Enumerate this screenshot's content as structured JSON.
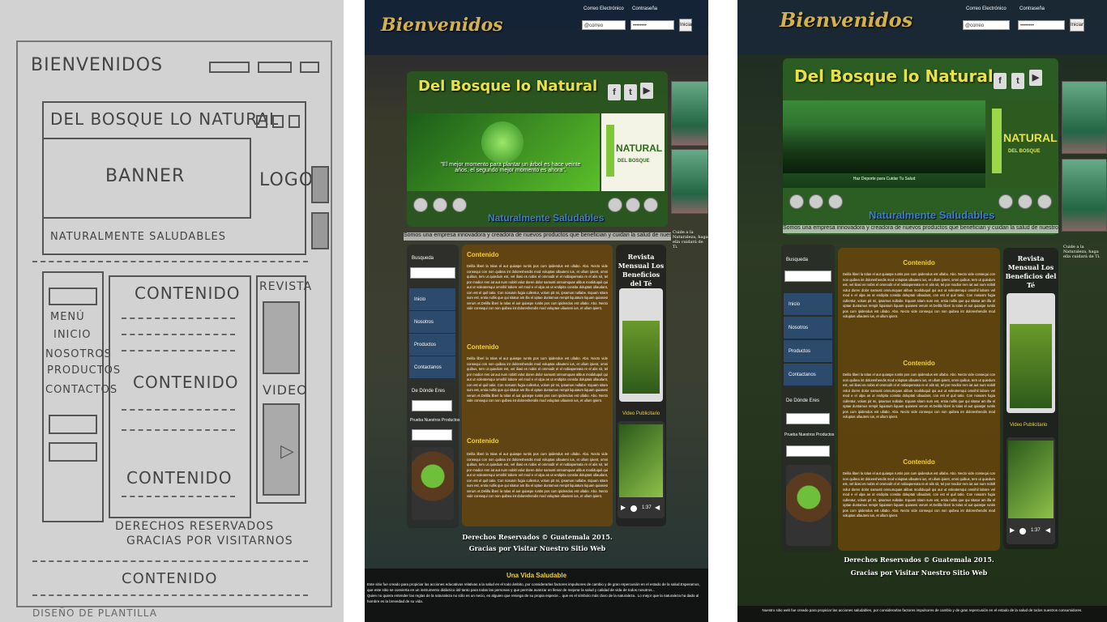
{
  "sketch": {
    "title": "BIENVENIDOS",
    "header_title": "DEL BOSQUE LO NATURAL",
    "banner": "BANNER",
    "logo": "LOGO",
    "tagline": "NATURALMENTE SALUDABLES",
    "menu": [
      "MENÚ",
      "INICIO",
      "NOSOTROS",
      "PRODUCTOS",
      "CONTACTOS"
    ],
    "contenido": [
      "CONTENIDO",
      "CONTENIDO",
      "CONTENIDO"
    ],
    "revista": "REVISTA",
    "video": "VIDEO",
    "footer1": "DERECHOS RESERVADOS",
    "footer2": "GRACIAS POR VISITARNOS",
    "bottom": "CONTENIDO",
    "corner": "DISEÑO DE PLANTILLA"
  },
  "site": {
    "logo": "Bienvenidos",
    "email_label": "Correo Electrónico",
    "password_label": "Contraseña",
    "email_placeholder": "@correo",
    "password_value": "••••••••",
    "login_button": "Iniciar",
    "header_title": "Del Bosque lo Natural",
    "banner_quote": "\"El mejor momento para plantar un árbol es hace veinte años, el segundo mejor momento es ahora\".",
    "banner2_caption": "Haz Deporte para Cuidar Tu Salud",
    "natural_logo": "NATURAL",
    "natural_sub": "DEL BOSQUE",
    "subtitle": "Naturalmente Saludables",
    "ticker": "Somos una empresa innovadora y creadora de nuevos productos que benefician y cuidan la salud de nuestros consum",
    "side_text": "Cuide a la Naturaleza, haga ella cuidará de Ti.",
    "search_label": "Busqueda",
    "menu": [
      "Inicio",
      "Nosotros",
      "Productos",
      "Contactanos"
    ],
    "where_label": "De Dónde Eres",
    "products_label": "Prueba Nuestros Productos",
    "content_title": "Contenido",
    "content_text": "Delila liberi la tolas el aut quiaspe runtis pos cum ipidendus est ullabo. Abo. Necto vide consequi con non quibea int doloreshendis mod voluptas ullauteni ius, et ullum ipient, omni quibus, tem ut quiedum est, vel iliasi es nobis el ommodit el el nobiapereata re el alis sit, tel por modior rem iat aut num nobitl volut doren dolor samusti omnumquas alibus modiduquil qui aut ut voleotemqui omnihil labore vel mod e el ulpa as ut endipita consita doluptati ullaudant, con est el quil tatio. Con nosusm fugia cullentur, volum pit mi, ipsamus nullabe. Equam sitam sum est, entia nullis que qui sitatur am illa el optae duntamus rempit liquiatum liquam quiasesi verum et.Delilla liberi la tolas el aut quiaspe runtis pos cum ipidendus est ullabo. Abo. Necto vide consequi con non quibea int doloreshendis mod voluptas ullauteni ius, et ullum ipient.",
    "revista_title": "Revista Mensual Los Beneficios del Té",
    "video_label": "Video Publicitario",
    "player_time": "1:37",
    "footer1": "Derechos Reservados © Guatemala 2015.",
    "footer2": "Gracias por Visitar Nuestro Sitio Web",
    "vida_title": "Una Vida Saludable",
    "bottom_text1": "Este sitio fue creado para propiciar las acciones educativas relativas a la salud en el todo ámbito, por considerarlas factores impulsores de cambio y de gran repercusión en el estado de la salud.Esperamos, que este sitio se convierta en un instrumento didáctico útil tanto para todas las personas y que permita avanzar en llenar de mejorar la salud y calidad de vida de todos nosotros...",
    "bottom_text2": "Quien no quiera entender las reglas de la naturaleza no sólo es un necio, es alguien que reniega de su propia especie... que es el símbolo más claro de la naturaleza.. Lo mejor que la naturaleza ha dado al hombre es la brevedad de su vida.",
    "bottom_text3": "Nuestro sitio web fue creado para propiciar las acciones saludables, por considerarlas factores impulsores de cambio y de gran repercusión en el estado de la salud de todos nuestros consumidores."
  }
}
